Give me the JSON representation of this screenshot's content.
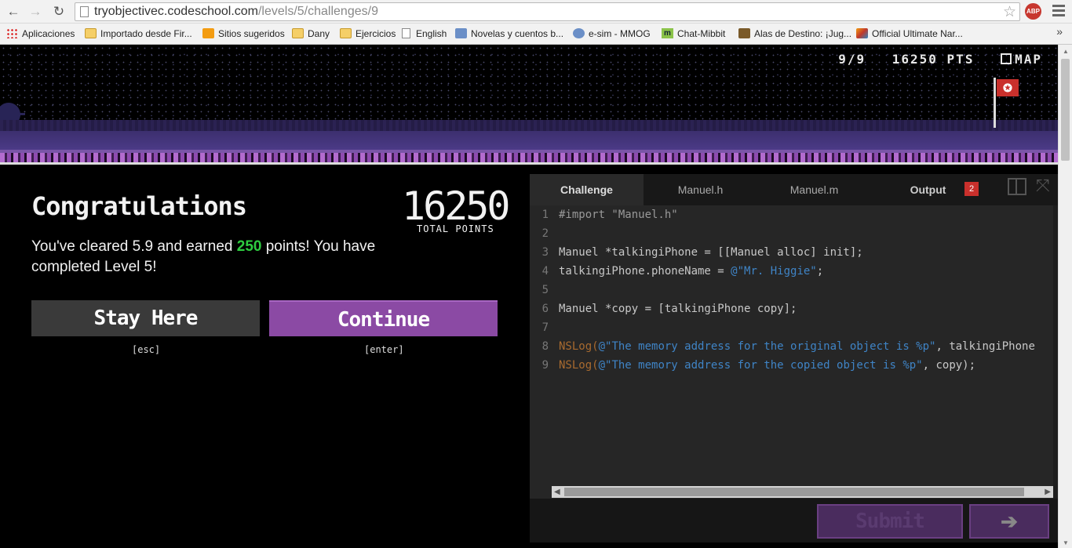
{
  "browser": {
    "url_host": "tryobjectivec.codeschool.com",
    "url_path": "/levels/5/challenges/9",
    "abp_label": "ABP",
    "bookmarks": [
      {
        "label": "Aplicaciones",
        "icon": "apps-icon"
      },
      {
        "label": "Importado desde Fir...",
        "icon": "folder-icon"
      },
      {
        "label": "Sitios sugeridos",
        "icon": "suggested-sites-icon"
      },
      {
        "label": "Dany",
        "icon": "folder-icon"
      },
      {
        "label": "Ejercicios",
        "icon": "folder-icon"
      },
      {
        "label": "English",
        "icon": "page-icon"
      },
      {
        "label": "Novelas y cuentos b...",
        "icon": "site-icon"
      },
      {
        "label": "e-sim - MMOG",
        "icon": "globe-icon"
      },
      {
        "label": "Chat-Mibbit",
        "icon": "mibbit-icon"
      },
      {
        "label": "Alas de Destino: ¡Jug...",
        "icon": "site-icon"
      },
      {
        "label": "Official Ultimate Nar...",
        "icon": "site-icon"
      }
    ],
    "overflow": "»"
  },
  "game": {
    "progress": "9/9",
    "points": "16250 PTS",
    "map_label": "MAP",
    "flag_glyph": "✪"
  },
  "result": {
    "title": "Congratulations",
    "total_points": "16250",
    "total_points_caption": "TOTAL POINTS",
    "message_before": "You've cleared 5.9 and earned ",
    "points_earned": "250",
    "message_after": " points! You have completed Level 5!",
    "stay_label": "Stay Here",
    "stay_shortcut": "[esc]",
    "continue_label": "Continue",
    "continue_shortcut": "[enter]"
  },
  "editor": {
    "tabs": [
      "Challenge",
      "Manuel.h",
      "Manuel.m",
      "Output"
    ],
    "output_badge": "2",
    "line_numbers": [
      "1",
      "2",
      "3",
      "4",
      "5",
      "6",
      "7",
      "8",
      "9"
    ],
    "code": {
      "l1": "#import \"Manuel.h\"",
      "l3": "Manuel *talkingiPhone = [[Manuel alloc] init];",
      "l4a": "talkingiPhone.phoneName = ",
      "l4b": "@\"Mr. Higgie\"",
      "l4c": ";",
      "l6": "Manuel *copy = [talkingiPhone copy];",
      "l8a": "NSLog",
      "l8b": "(",
      "l8c": "@\"The memory address for the original object is %p\"",
      "l8d": ", talkingiPhone",
      "l9a": "NSLog",
      "l9b": "(",
      "l9c": "@\"The memory address for the copied object is %p\"",
      "l9d": ", copy);"
    },
    "submit_label": "Submit",
    "next_glyph": "➔"
  }
}
